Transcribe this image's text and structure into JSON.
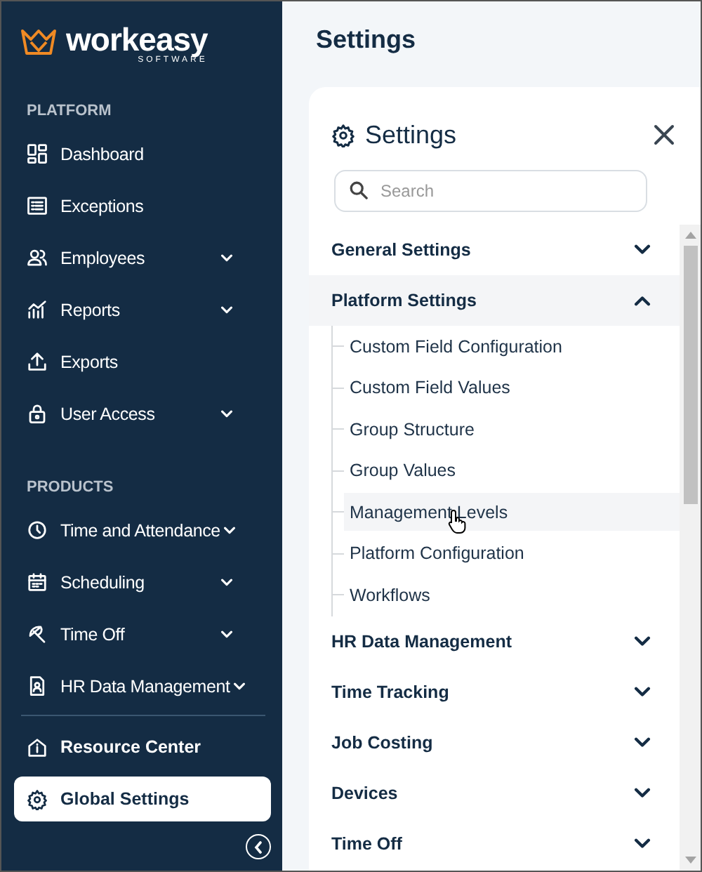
{
  "sidebar": {
    "logo": {
      "name": "workeasy",
      "tagline": "SOFTWARE"
    },
    "sections": [
      {
        "label": "PLATFORM",
        "items": [
          {
            "label": "Dashboard",
            "has_submenu": false,
            "selected": false
          },
          {
            "label": "Exceptions",
            "has_submenu": false,
            "selected": false
          },
          {
            "label": "Employees",
            "has_submenu": true,
            "selected": false
          },
          {
            "label": "Reports",
            "has_submenu": true,
            "selected": false
          },
          {
            "label": "Exports",
            "has_submenu": false,
            "selected": false
          },
          {
            "label": "User Access",
            "has_submenu": true,
            "selected": false
          }
        ]
      },
      {
        "label": "PRODUCTS",
        "items": [
          {
            "label": "Time and Attendance",
            "has_submenu": true,
            "selected": false
          },
          {
            "label": "Scheduling",
            "has_submenu": true,
            "selected": false
          },
          {
            "label": "Time Off",
            "has_submenu": true,
            "selected": false
          },
          {
            "label": "HR Data Management",
            "has_submenu": true,
            "selected": false
          }
        ]
      }
    ],
    "footer_items": [
      {
        "label": "Resource Center",
        "selected": false
      },
      {
        "label": "Global Settings",
        "selected": true
      }
    ]
  },
  "page": {
    "title": "Settings"
  },
  "settings_panel": {
    "title": "Settings",
    "search": {
      "placeholder": "Search"
    },
    "groups": [
      {
        "label": "General Settings",
        "expanded": false
      },
      {
        "label": "Platform Settings",
        "expanded": true,
        "children": [
          {
            "label": "Custom Field Configuration",
            "hovered": false
          },
          {
            "label": "Custom Field Values",
            "hovered": false
          },
          {
            "label": "Group Structure",
            "hovered": false
          },
          {
            "label": "Group Values",
            "hovered": false
          },
          {
            "label": "Management Levels",
            "hovered": true
          },
          {
            "label": "Platform Configuration",
            "hovered": false
          },
          {
            "label": "Workflows",
            "hovered": false
          }
        ]
      },
      {
        "label": "HR Data Management",
        "expanded": false
      },
      {
        "label": "Time Tracking",
        "expanded": false
      },
      {
        "label": "Job Costing",
        "expanded": false
      },
      {
        "label": "Devices",
        "expanded": false
      },
      {
        "label": "Time Off",
        "expanded": false
      }
    ]
  }
}
